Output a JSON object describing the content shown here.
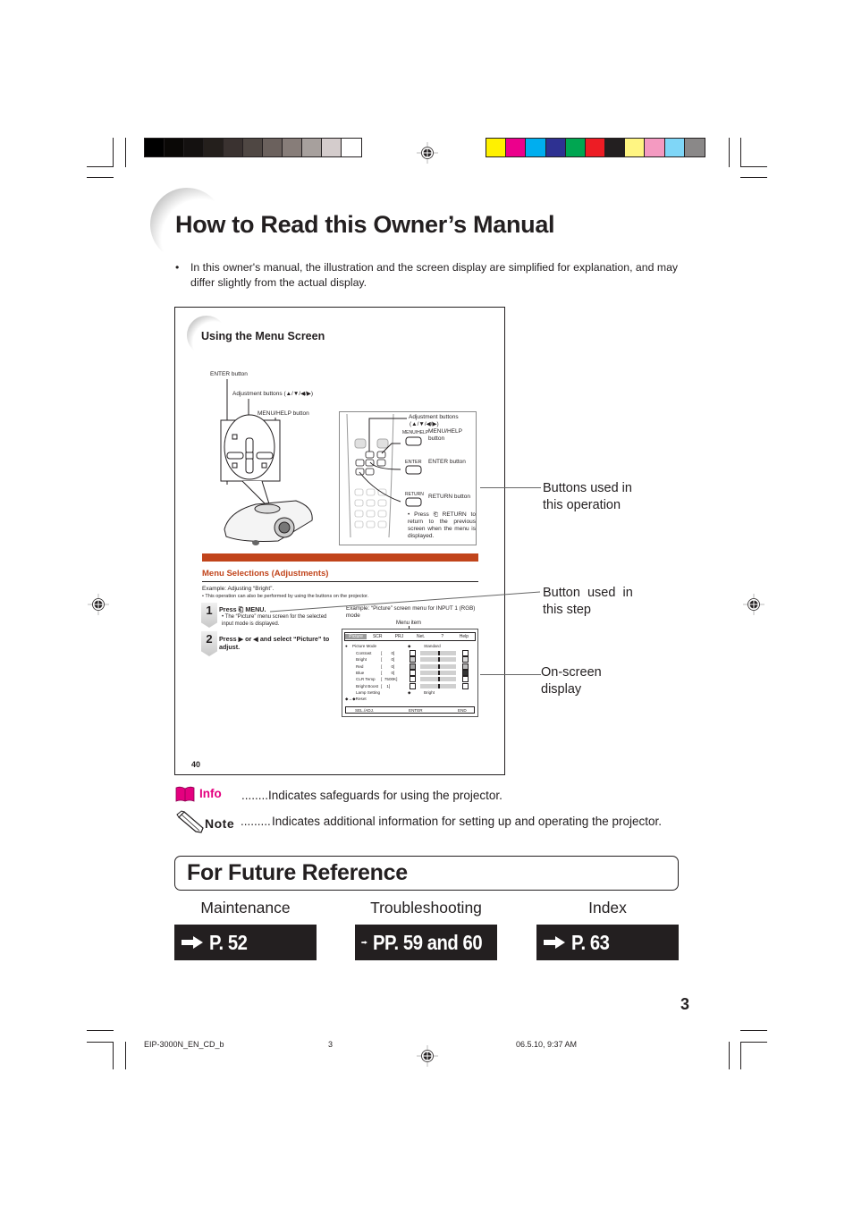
{
  "print_marks": {
    "grayscale_swatches": [
      "#000000",
      "#0a0806",
      "#141110",
      "#241f1c",
      "#3a3230",
      "#4f4743",
      "#6b615d",
      "#877d79",
      "#a7a09d",
      "#d4cccc",
      "#ffffff"
    ],
    "color_swatches": [
      "#fff100",
      "#ec008c",
      "#00aeef",
      "#2e3192",
      "#00a651",
      "#ed1c24",
      "#231f20",
      "#fff582",
      "#f49ac1",
      "#7fd6f7",
      "#8a8888"
    ]
  },
  "header": {
    "title": "How to Read this Owner’s Manual",
    "intro_bullet": "•",
    "intro_text": "In this owner's manual, the illustration and the screen display are simplified for explanation, and may differ slightly from the actual display."
  },
  "sample_page": {
    "subtitle": "Using the Menu Screen",
    "labels": {
      "enter_button": "ENTER button",
      "adjustment_buttons": "Adjustment buttons (▲/▼/◀/▶)",
      "menu_help_button": "MENU/HELP button"
    },
    "remote": {
      "adjustment_buttons_line1": "Adjustment buttons",
      "adjustment_buttons_line2": "(▲/▼/◀/▶)",
      "menu_help_key": "MENU/HELP",
      "menu_help_label_line1": "MENU/HELP",
      "menu_help_label_line2": "button",
      "enter_key": "ENTER",
      "enter_label": "ENTER button",
      "return_key": "RETURN",
      "return_label": "RETURN button",
      "return_note": "• Press ⎗ RETURN to return to the previous screen when the menu is displayed."
    },
    "section_heading": "Menu Selections (Adjustments)",
    "example_line": "Example: Adjusting “Bright”.",
    "example_note": "• This operation can also be performed by using the buttons on the projector.",
    "steps": [
      {
        "number": "1",
        "text": "Press ⎗ MENU.",
        "note": "• The “Picture” menu screen for the selected input mode is displayed."
      },
      {
        "number": "2",
        "text": "Press ▶ or ◀ and select “Picture” to adjust.",
        "note": ""
      }
    ],
    "osd_caption": "Example: “Picture” screen menu for INPUT 1 (RGB) mode",
    "menu_item_label": "Menu item",
    "osd": {
      "tabs": [
        "Picture",
        "SCR",
        "PRJ",
        "Net.",
        "?",
        "Help"
      ],
      "active_tab": "Picture",
      "picture_mode_label": "Picture Mode",
      "picture_mode_value": "Standard",
      "rows": [
        {
          "label": "Contrast",
          "value": "[        0]"
        },
        {
          "label": "Bright",
          "value": "[        0]"
        },
        {
          "label": "Red",
          "value": "[        0]"
        },
        {
          "label": "Blue",
          "value": "[        0]"
        },
        {
          "label": "CLR Temp",
          "value": "[  7500K]"
        },
        {
          "label": "Bright Boost",
          "value": "[    1]"
        }
      ],
      "lamp_setting_label": "Lamp Setting",
      "lamp_setting_value": "Bright",
      "reset_label": "◆→◆Reset",
      "footer": [
        "SEL./ADJ.",
        "ENTER",
        "END"
      ]
    },
    "page_number": "40"
  },
  "callouts": [
    {
      "line1": "Buttons used in",
      "line2": "this operation"
    },
    {
      "line1": "Button  used  in",
      "line2": "this step"
    },
    {
      "line1": "On-screen",
      "line2": "display"
    }
  ],
  "legend": {
    "info_label": "Info",
    "info_text": "........Indicates safeguards for using the projector.",
    "note_label": "Note",
    "note_dots": ".........",
    "note_text": "Indicates additional information for setting up and operating the projector."
  },
  "future_reference": {
    "title": "For Future Reference",
    "links": [
      {
        "label": "Maintenance",
        "target": "P. 52"
      },
      {
        "label": "Troubleshooting",
        "target": "PP. 59 and 60"
      },
      {
        "label": "Index",
        "target": "P. 63"
      }
    ]
  },
  "page_number": "3",
  "footer": {
    "file_name": "EIP-3000N_EN_CD_b",
    "sheet_number": "3",
    "timestamp": "06.5.10, 9:37 AM"
  },
  "colors": {
    "accent_orange": "#c1441b",
    "info_pink": "#e4007f",
    "text": "#231f20"
  }
}
